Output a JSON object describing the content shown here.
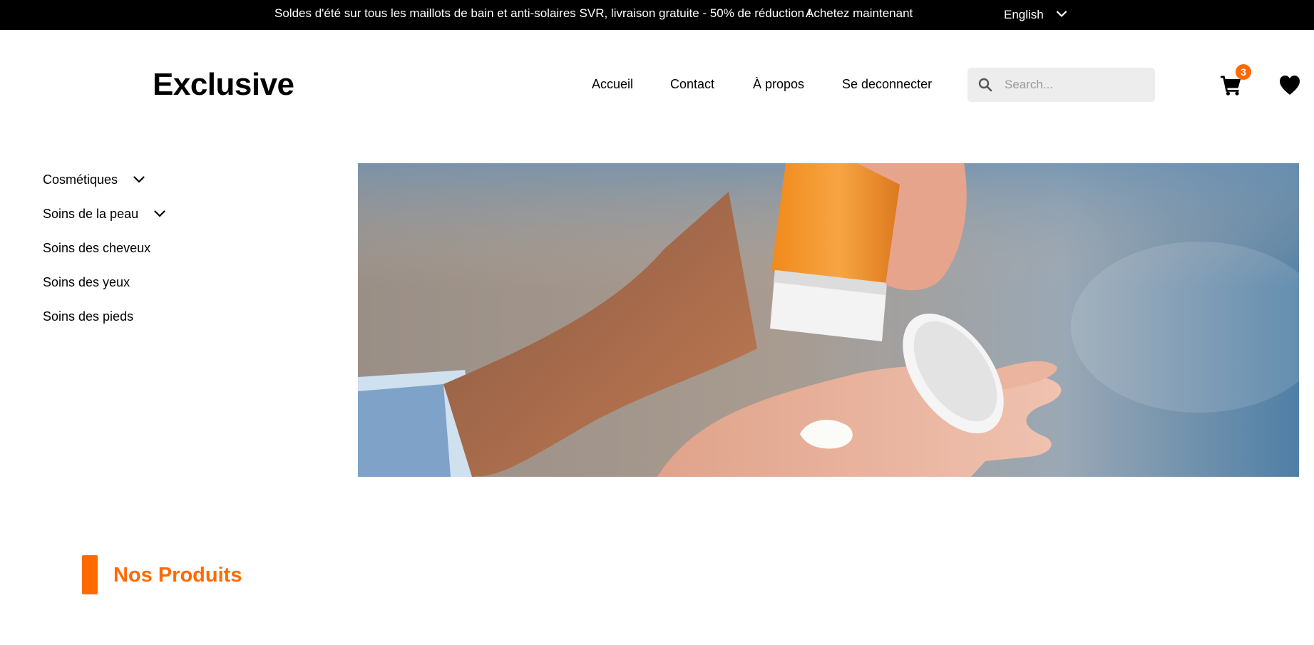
{
  "topbar": {
    "promo": "Soldes d'été sur tous les maillots de bain et anti-solaires SVR, livraison gratuite - 50% de réduction !",
    "shop_link": "Achetez maintenant",
    "language": "English"
  },
  "header": {
    "logo": "Exclusive",
    "nav": [
      "Accueil",
      "Contact",
      "À propos",
      "Se deconnecter"
    ],
    "search_placeholder": "Search...",
    "cart_count": "3"
  },
  "sidebar": {
    "categories": [
      {
        "label": "Cosmétiques",
        "has_dropdown": true
      },
      {
        "label": "Soins de la peau",
        "has_dropdown": true
      },
      {
        "label": "Soins des cheveux",
        "has_dropdown": false
      },
      {
        "label": "Soins des yeux",
        "has_dropdown": false
      },
      {
        "label": "Soins des pieds",
        "has_dropdown": false
      }
    ]
  },
  "hero": {
    "image": "sunscreen-on-beach-photo"
  },
  "section": {
    "title": "Nos Produits"
  },
  "colors": {
    "accent": "#ff6a00",
    "topbar_bg": "#000000",
    "search_bg": "#ededed"
  },
  "icons": [
    "chevron-down-icon",
    "search-icon",
    "cart-icon",
    "heart-icon"
  ]
}
